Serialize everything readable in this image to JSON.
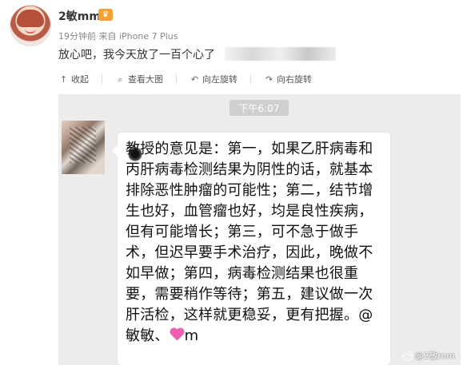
{
  "post": {
    "author": "2敏mm",
    "badge": "",
    "meta": "19分钟前 来自 iPhone 7 Plus",
    "text": "放心吧，我今天放了一百个心了"
  },
  "actions": [
    {
      "label": "收起",
      "icon": "collapse-icon"
    },
    {
      "label": "查看大图",
      "icon": "search-icon"
    },
    {
      "label": "向左旋转",
      "icon": "rotate-left-icon"
    },
    {
      "label": "向右旋转",
      "icon": "rotate-right-icon"
    }
  ],
  "chat": {
    "time": "下午6:07",
    "message": "教授的意见是：第一，如果乙肝病毒和丙肝病毒检测结果为阴性的话，就基本排除恶性肿瘤的可能性；第二，结节增生也好，血管瘤也好，均是良性疾病，但有可能增长；第三，可不急于做手术，但迟早要手术治疗，因此，晚做不如早做；第四，病毒检测结果也很重要，需要稍作等待；第五，建议做一次肝活检，这样就更稳妥，更有把握。@敏敏、",
    "message_tail": "m"
  },
  "watermark": {
    "text": "@2敏mm"
  },
  "colors": {
    "background": "#ffffff",
    "image_background": "#ececec",
    "bubble": "#ffffff",
    "time_pill": "#cfcfcf",
    "heart": "#f05eb2"
  }
}
